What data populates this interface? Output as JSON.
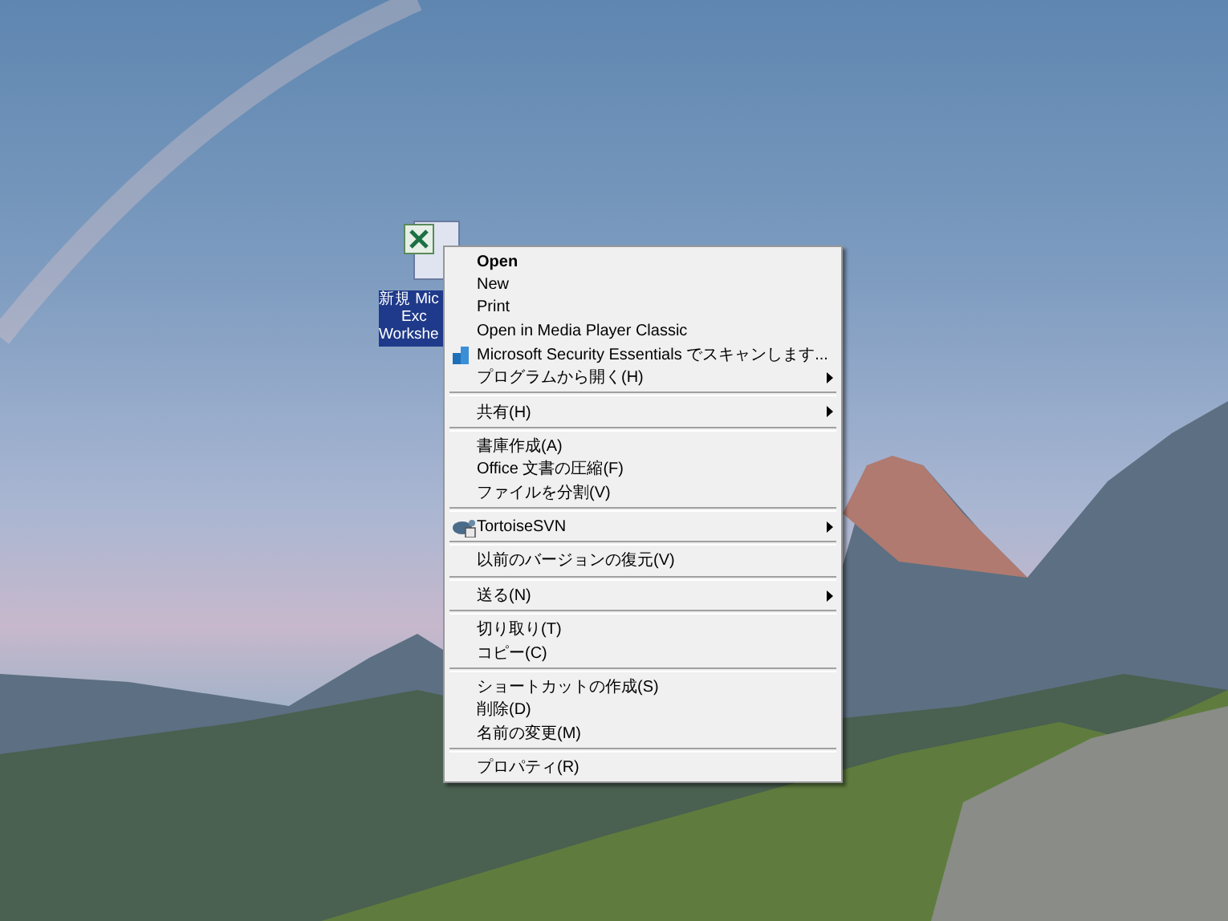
{
  "desktop_icon": {
    "label_lines": [
      "新規 Mic",
      "Exc",
      "Workshe"
    ],
    "selected": true
  },
  "context_menu": {
    "items": [
      {
        "kind": "item",
        "label": "Open",
        "default": true,
        "submenu": false
      },
      {
        "kind": "item",
        "label": "New",
        "default": false,
        "submenu": false
      },
      {
        "kind": "item",
        "label": "Print",
        "default": false,
        "submenu": false
      },
      {
        "kind": "item",
        "label": "Open in Media Player Classic",
        "default": false,
        "submenu": false
      },
      {
        "kind": "scan",
        "label": "Microsoft Security Essentials でスキャンします...",
        "default": false,
        "submenu": false
      },
      {
        "kind": "item",
        "label": "プログラムから開く(H)",
        "default": false,
        "submenu": true
      },
      {
        "kind": "separator"
      },
      {
        "kind": "item",
        "label": "共有(H)",
        "default": false,
        "submenu": true
      },
      {
        "kind": "separator"
      },
      {
        "kind": "item",
        "label": "書庫作成(A)",
        "default": false,
        "submenu": false
      },
      {
        "kind": "item",
        "label": "Office 文書の圧縮(F)",
        "default": false,
        "submenu": false
      },
      {
        "kind": "item",
        "label": "ファイルを分割(V)",
        "default": false,
        "submenu": false
      },
      {
        "kind": "separator"
      },
      {
        "kind": "tortoise",
        "label": "TortoiseSVN",
        "default": false,
        "submenu": true
      },
      {
        "kind": "separator"
      },
      {
        "kind": "item",
        "label": "以前のバージョンの復元(V)",
        "default": false,
        "submenu": false
      },
      {
        "kind": "separator"
      },
      {
        "kind": "item",
        "label": "送る(N)",
        "default": false,
        "submenu": true
      },
      {
        "kind": "separator"
      },
      {
        "kind": "item",
        "label": "切り取り(T)",
        "default": false,
        "submenu": false
      },
      {
        "kind": "item",
        "label": "コピー(C)",
        "default": false,
        "submenu": false
      },
      {
        "kind": "separator"
      },
      {
        "kind": "item",
        "label": "ショートカットの作成(S)",
        "default": false,
        "submenu": false
      },
      {
        "kind": "item",
        "label": "削除(D)",
        "default": false,
        "submenu": false
      },
      {
        "kind": "item",
        "label": "名前の変更(M)",
        "default": false,
        "submenu": false
      },
      {
        "kind": "separator"
      },
      {
        "kind": "item",
        "label": "プロパティ(R)",
        "default": false,
        "submenu": false
      }
    ]
  }
}
